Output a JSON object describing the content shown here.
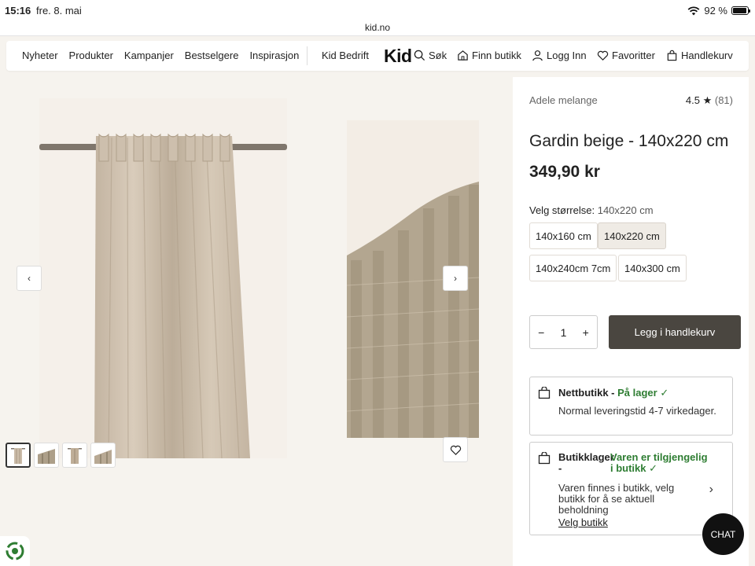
{
  "status_bar": {
    "time": "15:16",
    "date": "fre. 8. mai",
    "battery": "92 %",
    "battery_level": 0.92
  },
  "url": "kid.no",
  "header": {
    "nav": [
      "Nyheter",
      "Produkter",
      "Kampanjer",
      "Bestselgere",
      "Inspirasjon"
    ],
    "bedrift": "Kid Bedrift",
    "logo": "Kid",
    "search": "Søk",
    "find_store": "Finn butikk",
    "login": "Logg Inn",
    "favorites": "Favoritter",
    "cart": "Handlekurv"
  },
  "gallery": {
    "prev": "‹",
    "next": "›",
    "thumbnail_count": 4
  },
  "product": {
    "brand": "Adele melange",
    "rating": "4.5",
    "rating_star": "★",
    "rating_count": "(81)",
    "title": "Gardin beige - 140x220 cm",
    "price": "349,90 kr",
    "size_label": "Velg størrelse:",
    "selected_size": "140x220 cm",
    "sizes": [
      "140x160 cm",
      "140x220 cm",
      "140x240cm 7cm",
      "140x300 cm"
    ],
    "quantity": "1",
    "qty_minus": "−",
    "qty_plus": "+",
    "add_to_cart": "Legg i handlekurv"
  },
  "availability": {
    "online_title": "Nettbutikk -",
    "online_status": "På lager",
    "online_desc": "Normal leveringstid 4-7 virkedager.",
    "store_title": "Butikklager",
    "store_dash": "-",
    "store_status": "Varen er tilgjengelig i butikk",
    "store_desc": "Varen finnes i butikk, velg butikk for å se aktuell beholdning",
    "store_link": "Velg butikk"
  },
  "chat": "CHAT",
  "colors": {
    "accent_dark": "#4a4640",
    "in_stock": "#2e7d32",
    "page_bg": "#f6f3ee"
  }
}
